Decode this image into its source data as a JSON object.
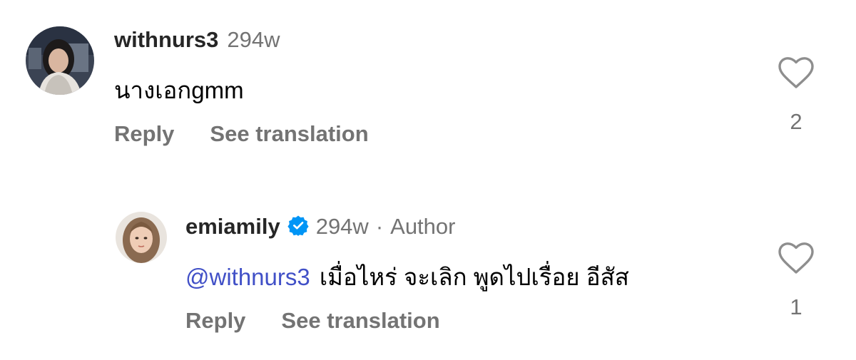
{
  "comments": [
    {
      "username": "withnurs3",
      "time": "294w",
      "text": "นางเอกgmm",
      "reply_label": "Reply",
      "translate_label": "See translation",
      "like_count": "2"
    },
    {
      "username": "emiamily",
      "verified": true,
      "time": "294w",
      "separator": "·",
      "author_label": "Author",
      "mention": "@withnurs3",
      "text": "เมื่อไหร่ จะเลิก พูดไปเรื่อย อีสัส",
      "reply_label": "Reply",
      "translate_label": "See translation",
      "like_count": "1"
    }
  ],
  "colors": {
    "meta_gray": "#737373",
    "mention_blue": "#4150c7",
    "verified_blue": "#0095f6",
    "heart_stroke": "#8e8e8e"
  },
  "icons": {
    "like": "heart-outline-icon",
    "verified": "verified-badge-icon"
  }
}
